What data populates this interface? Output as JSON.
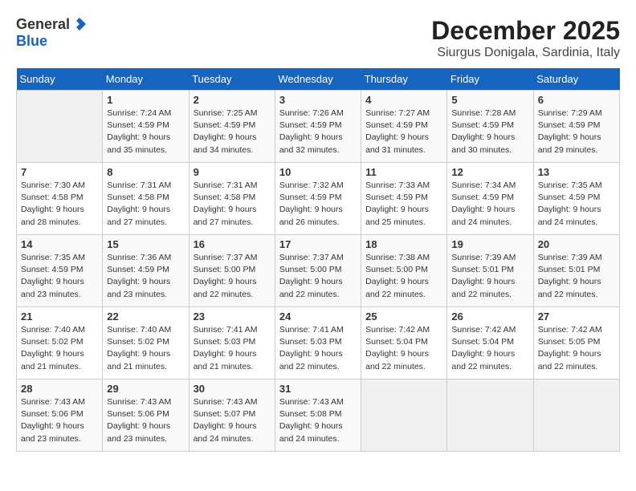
{
  "header": {
    "logo": {
      "general": "General",
      "blue": "Blue"
    },
    "title": "December 2025",
    "location": "Siurgus Donigala, Sardinia, Italy"
  },
  "weekdays": [
    "Sunday",
    "Monday",
    "Tuesday",
    "Wednesday",
    "Thursday",
    "Friday",
    "Saturday"
  ],
  "weeks": [
    [
      {
        "day": "",
        "info": ""
      },
      {
        "day": "1",
        "info": "Sunrise: 7:24 AM\nSunset: 4:59 PM\nDaylight: 9 hours\nand 35 minutes."
      },
      {
        "day": "2",
        "info": "Sunrise: 7:25 AM\nSunset: 4:59 PM\nDaylight: 9 hours\nand 34 minutes."
      },
      {
        "day": "3",
        "info": "Sunrise: 7:26 AM\nSunset: 4:59 PM\nDaylight: 9 hours\nand 32 minutes."
      },
      {
        "day": "4",
        "info": "Sunrise: 7:27 AM\nSunset: 4:59 PM\nDaylight: 9 hours\nand 31 minutes."
      },
      {
        "day": "5",
        "info": "Sunrise: 7:28 AM\nSunset: 4:59 PM\nDaylight: 9 hours\nand 30 minutes."
      },
      {
        "day": "6",
        "info": "Sunrise: 7:29 AM\nSunset: 4:59 PM\nDaylight: 9 hours\nand 29 minutes."
      }
    ],
    [
      {
        "day": "7",
        "info": "Sunrise: 7:30 AM\nSunset: 4:58 PM\nDaylight: 9 hours\nand 28 minutes."
      },
      {
        "day": "8",
        "info": "Sunrise: 7:31 AM\nSunset: 4:58 PM\nDaylight: 9 hours\nand 27 minutes."
      },
      {
        "day": "9",
        "info": "Sunrise: 7:31 AM\nSunset: 4:58 PM\nDaylight: 9 hours\nand 27 minutes."
      },
      {
        "day": "10",
        "info": "Sunrise: 7:32 AM\nSunset: 4:59 PM\nDaylight: 9 hours\nand 26 minutes."
      },
      {
        "day": "11",
        "info": "Sunrise: 7:33 AM\nSunset: 4:59 PM\nDaylight: 9 hours\nand 25 minutes."
      },
      {
        "day": "12",
        "info": "Sunrise: 7:34 AM\nSunset: 4:59 PM\nDaylight: 9 hours\nand 24 minutes."
      },
      {
        "day": "13",
        "info": "Sunrise: 7:35 AM\nSunset: 4:59 PM\nDaylight: 9 hours\nand 24 minutes."
      }
    ],
    [
      {
        "day": "14",
        "info": "Sunrise: 7:35 AM\nSunset: 4:59 PM\nDaylight: 9 hours\nand 23 minutes."
      },
      {
        "day": "15",
        "info": "Sunrise: 7:36 AM\nSunset: 4:59 PM\nDaylight: 9 hours\nand 23 minutes."
      },
      {
        "day": "16",
        "info": "Sunrise: 7:37 AM\nSunset: 5:00 PM\nDaylight: 9 hours\nand 22 minutes."
      },
      {
        "day": "17",
        "info": "Sunrise: 7:37 AM\nSunset: 5:00 PM\nDaylight: 9 hours\nand 22 minutes."
      },
      {
        "day": "18",
        "info": "Sunrise: 7:38 AM\nSunset: 5:00 PM\nDaylight: 9 hours\nand 22 minutes."
      },
      {
        "day": "19",
        "info": "Sunrise: 7:39 AM\nSunset: 5:01 PM\nDaylight: 9 hours\nand 22 minutes."
      },
      {
        "day": "20",
        "info": "Sunrise: 7:39 AM\nSunset: 5:01 PM\nDaylight: 9 hours\nand 22 minutes."
      }
    ],
    [
      {
        "day": "21",
        "info": "Sunrise: 7:40 AM\nSunset: 5:02 PM\nDaylight: 9 hours\nand 21 minutes."
      },
      {
        "day": "22",
        "info": "Sunrise: 7:40 AM\nSunset: 5:02 PM\nDaylight: 9 hours\nand 21 minutes."
      },
      {
        "day": "23",
        "info": "Sunrise: 7:41 AM\nSunset: 5:03 PM\nDaylight: 9 hours\nand 21 minutes."
      },
      {
        "day": "24",
        "info": "Sunrise: 7:41 AM\nSunset: 5:03 PM\nDaylight: 9 hours\nand 22 minutes."
      },
      {
        "day": "25",
        "info": "Sunrise: 7:42 AM\nSunset: 5:04 PM\nDaylight: 9 hours\nand 22 minutes."
      },
      {
        "day": "26",
        "info": "Sunrise: 7:42 AM\nSunset: 5:04 PM\nDaylight: 9 hours\nand 22 minutes."
      },
      {
        "day": "27",
        "info": "Sunrise: 7:42 AM\nSunset: 5:05 PM\nDaylight: 9 hours\nand 22 minutes."
      }
    ],
    [
      {
        "day": "28",
        "info": "Sunrise: 7:43 AM\nSunset: 5:06 PM\nDaylight: 9 hours\nand 23 minutes."
      },
      {
        "day": "29",
        "info": "Sunrise: 7:43 AM\nSunset: 5:06 PM\nDaylight: 9 hours\nand 23 minutes."
      },
      {
        "day": "30",
        "info": "Sunrise: 7:43 AM\nSunset: 5:07 PM\nDaylight: 9 hours\nand 24 minutes."
      },
      {
        "day": "31",
        "info": "Sunrise: 7:43 AM\nSunset: 5:08 PM\nDaylight: 9 hours\nand 24 minutes."
      },
      {
        "day": "",
        "info": ""
      },
      {
        "day": "",
        "info": ""
      },
      {
        "day": "",
        "info": ""
      }
    ]
  ]
}
